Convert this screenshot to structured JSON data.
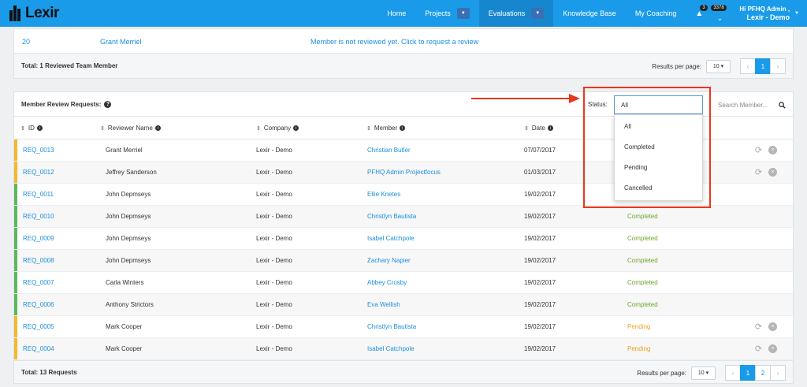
{
  "brand": {
    "name": "Lexir"
  },
  "nav": {
    "items": [
      {
        "label": "Home",
        "has_caret": false,
        "active": false
      },
      {
        "label": "Projects",
        "has_caret": true,
        "active": false
      },
      {
        "label": "Evaluations",
        "has_caret": true,
        "active": true
      },
      {
        "label": "Knowledge Base",
        "has_caret": false,
        "active": false
      },
      {
        "label": "My Coaching",
        "has_caret": false,
        "active": false
      }
    ],
    "alerts_count": "3",
    "messages_count": "3378",
    "user_greeting": "Hi PFHQ Admin ,",
    "user_org": "Lexir - Demo"
  },
  "top_panel": {
    "row": {
      "id": "20",
      "reviewer": "Grant Merriel",
      "message": "Member is not reviewed yet. Click to request a review"
    },
    "total": "Total: 1 Reviewed Team Member",
    "rpp_label": "Results per page:",
    "rpp_value": "10",
    "pages": [
      "1"
    ],
    "current_page": "1"
  },
  "main_panel": {
    "title": "Member Review Requests:",
    "status_label": "Status:",
    "status_value": "All",
    "search_placeholder": "Search Member...",
    "columns": [
      "ID",
      "Reviewer Name",
      "Company",
      "Member",
      "Date"
    ],
    "rows": [
      {
        "id": "REQ_0013",
        "reviewer": "Grant Merriel",
        "company": "Lexir - Demo",
        "member": "Christian Butler",
        "date": "07/07/2017",
        "status": "",
        "stripe": "#f5b82e",
        "actions": true
      },
      {
        "id": "REQ_0012",
        "reviewer": "Jeffrey Sanderson",
        "company": "Lexir - Demo",
        "member": "PFHQ Admin Projectfocus",
        "date": "01/03/2017",
        "status": "",
        "stripe": "#f5b82e",
        "actions": true
      },
      {
        "id": "REQ_0011",
        "reviewer": "John Depmseys",
        "company": "Lexir - Demo",
        "member": "Ellie Knetes",
        "date": "19/02/2017",
        "status": "",
        "stripe": "#5cb85c",
        "actions": false
      },
      {
        "id": "REQ_0010",
        "reviewer": "John Depmseys",
        "company": "Lexir - Demo",
        "member": "Christlyn Bautista",
        "date": "19/02/2017",
        "status": "Completed",
        "stripe": "#5cb85c",
        "actions": false
      },
      {
        "id": "REQ_0009",
        "reviewer": "John Depmseys",
        "company": "Lexir - Demo",
        "member": "Isabel Catchpole",
        "date": "19/02/2017",
        "status": "Completed",
        "stripe": "#5cb85c",
        "actions": false
      },
      {
        "id": "REQ_0008",
        "reviewer": "John Depmseys",
        "company": "Lexir - Demo",
        "member": "Zachary Napier",
        "date": "19/02/2017",
        "status": "Completed",
        "stripe": "#5cb85c",
        "actions": false
      },
      {
        "id": "REQ_0007",
        "reviewer": "Carla Winters",
        "company": "Lexir - Demo",
        "member": "Abbey Crosby",
        "date": "19/02/2017",
        "status": "Completed",
        "stripe": "#5cb85c",
        "actions": false
      },
      {
        "id": "REQ_0006",
        "reviewer": "Anthony Strictors",
        "company": "Lexir - Demo",
        "member": "Eva Wellish",
        "date": "19/02/2017",
        "status": "Completed",
        "stripe": "#5cb85c",
        "actions": false
      },
      {
        "id": "REQ_0005",
        "reviewer": "Mark Cooper",
        "company": "Lexir - Demo",
        "member": "Christlyn Bautista",
        "date": "19/02/2017",
        "status": "Pending",
        "stripe": "#f5b82e",
        "actions": true
      },
      {
        "id": "REQ_0004",
        "reviewer": "Mark Cooper",
        "company": "Lexir - Demo",
        "member": "Isabel Catchpole",
        "date": "19/02/2017",
        "status": "Pending",
        "stripe": "#f5b82e",
        "actions": true
      }
    ],
    "status_colors": {
      "Completed": "#6aa82e",
      "Pending": "#f0a020"
    },
    "dropdown_options": [
      "All",
      "Completed",
      "Pending",
      "Cancelled"
    ],
    "total": "Total: 13 Requests",
    "rpp_label": "Results per page:",
    "rpp_value": "10",
    "pages": [
      "1",
      "2"
    ],
    "current_page": "1"
  },
  "colors": {
    "brand_blue": "#1a9bea",
    "highlight_red": "#e8371e",
    "link": "#1a8fdd"
  }
}
